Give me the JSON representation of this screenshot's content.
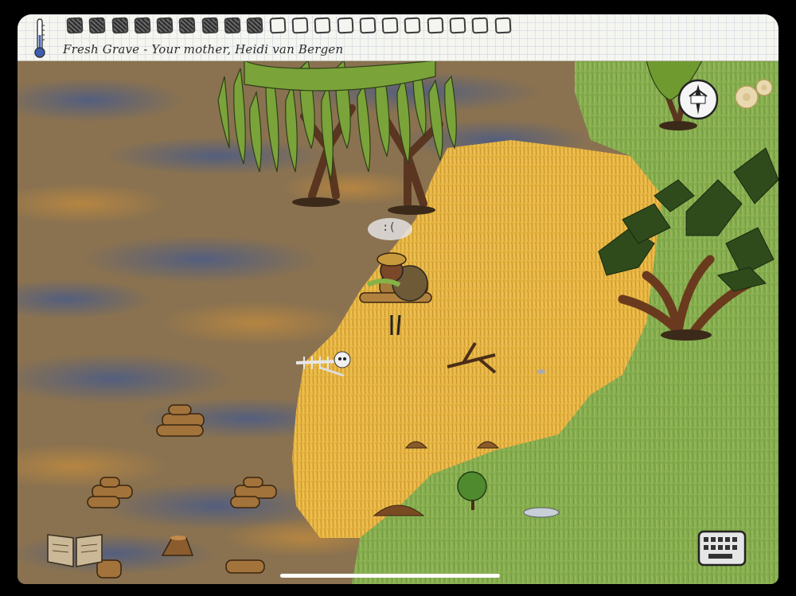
{
  "hud": {
    "status_text": "Fresh Grave - Your mother, Heidi van Bergen",
    "temperature_icon": "thermometer-icon",
    "food_meter": {
      "filled": 9,
      "total": 20
    }
  },
  "emote": {
    "text": ":("
  },
  "icons": {
    "compass": "home-compass-icon",
    "settings": "gear-icon",
    "keyboard": "keyboard-icon",
    "journal": "tech-book-icon"
  },
  "colors": {
    "swamp": "#7e6a48",
    "swamp_blue": "#4d5d84",
    "wheat": "#e7b540",
    "grass": "#86ad4e",
    "hud_bg": "#f6f6f1"
  }
}
